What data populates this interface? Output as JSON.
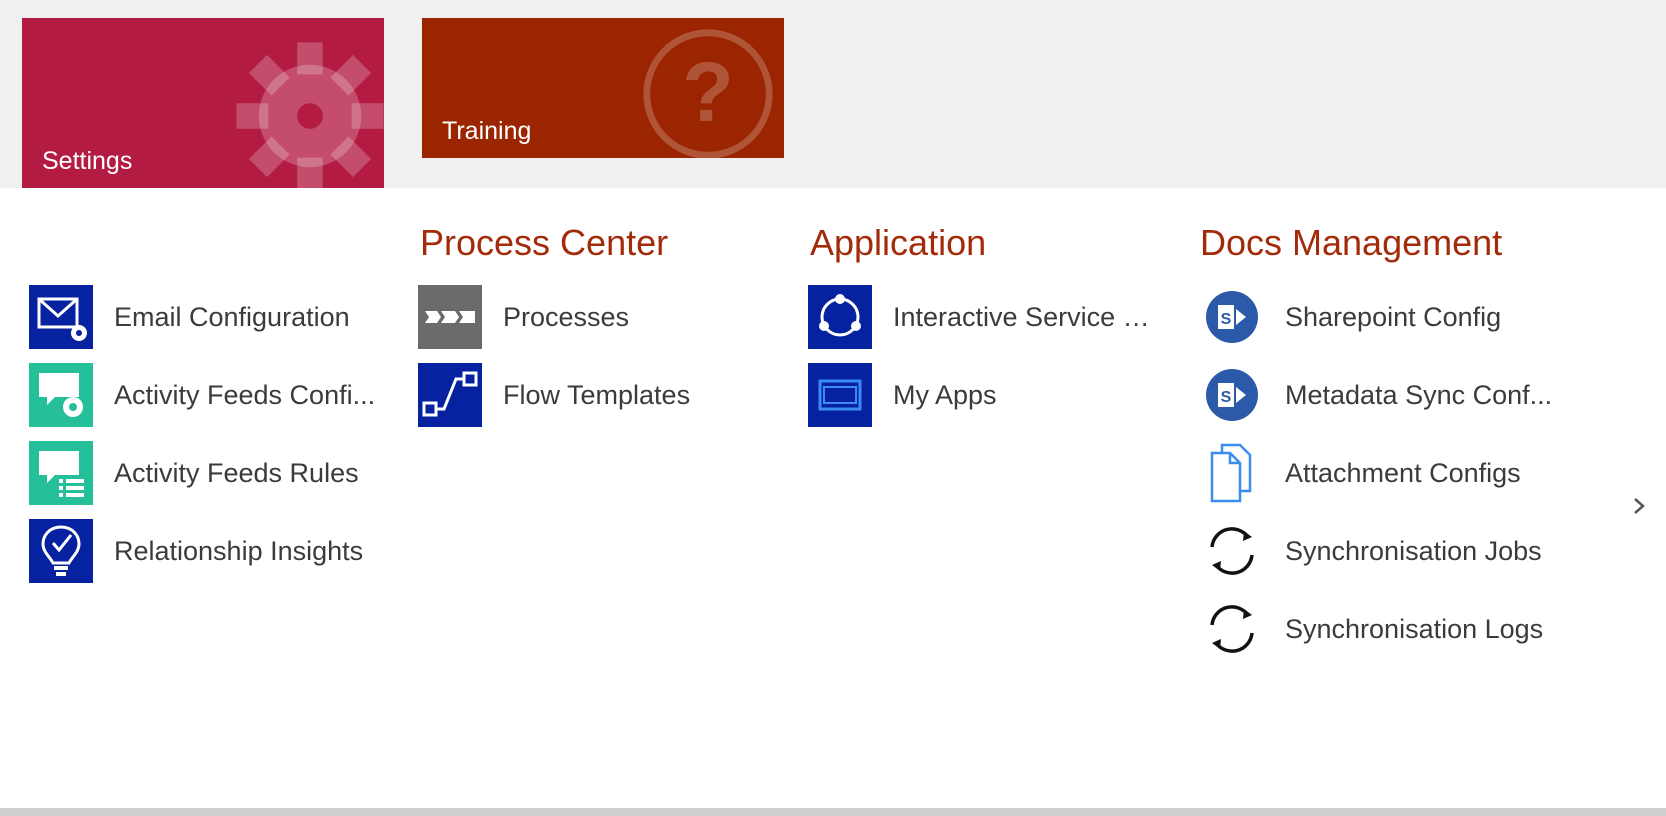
{
  "tiles": {
    "settings": {
      "label": "Settings",
      "color": "#b31b42",
      "icon": "gear-icon"
    },
    "training": {
      "label": "Training",
      "color": "#9a2500",
      "icon": "question-icon"
    }
  },
  "columns": [
    {
      "title": "",
      "items": [
        {
          "label": "Email Configuration",
          "icon": "email-config-icon"
        },
        {
          "label": "Activity Feeds Confi...",
          "icon": "activity-feeds-config-icon"
        },
        {
          "label": "Activity Feeds Rules",
          "icon": "activity-feeds-rules-icon"
        },
        {
          "label": "Relationship Insights",
          "icon": "relationship-insights-icon"
        }
      ]
    },
    {
      "title": "Process Center",
      "items": [
        {
          "label": "Processes",
          "icon": "processes-icon"
        },
        {
          "label": "Flow Templates",
          "icon": "flow-templates-icon"
        }
      ]
    },
    {
      "title": "Application",
      "items": [
        {
          "label": "Interactive Service H...",
          "icon": "interactive-service-hub-icon"
        },
        {
          "label": "My Apps",
          "icon": "my-apps-icon"
        }
      ]
    },
    {
      "title": "Docs Management",
      "items": [
        {
          "label": "Sharepoint Config",
          "icon": "sharepoint-icon"
        },
        {
          "label": "Metadata Sync Conf...",
          "icon": "sharepoint-icon"
        },
        {
          "label": "Attachment Configs",
          "icon": "documents-icon"
        },
        {
          "label": "Synchronisation Jobs",
          "icon": "sync-icon"
        },
        {
          "label": "Synchronisation Logs",
          "icon": "sync-icon"
        }
      ]
    }
  ],
  "colors": {
    "section_title": "#a32b0a",
    "icon_blue": "#0722a0",
    "icon_teal": "#25c09a",
    "icon_gray": "#6b6b6b"
  },
  "navigation": {
    "scroll_right": "chevron-right-icon"
  }
}
